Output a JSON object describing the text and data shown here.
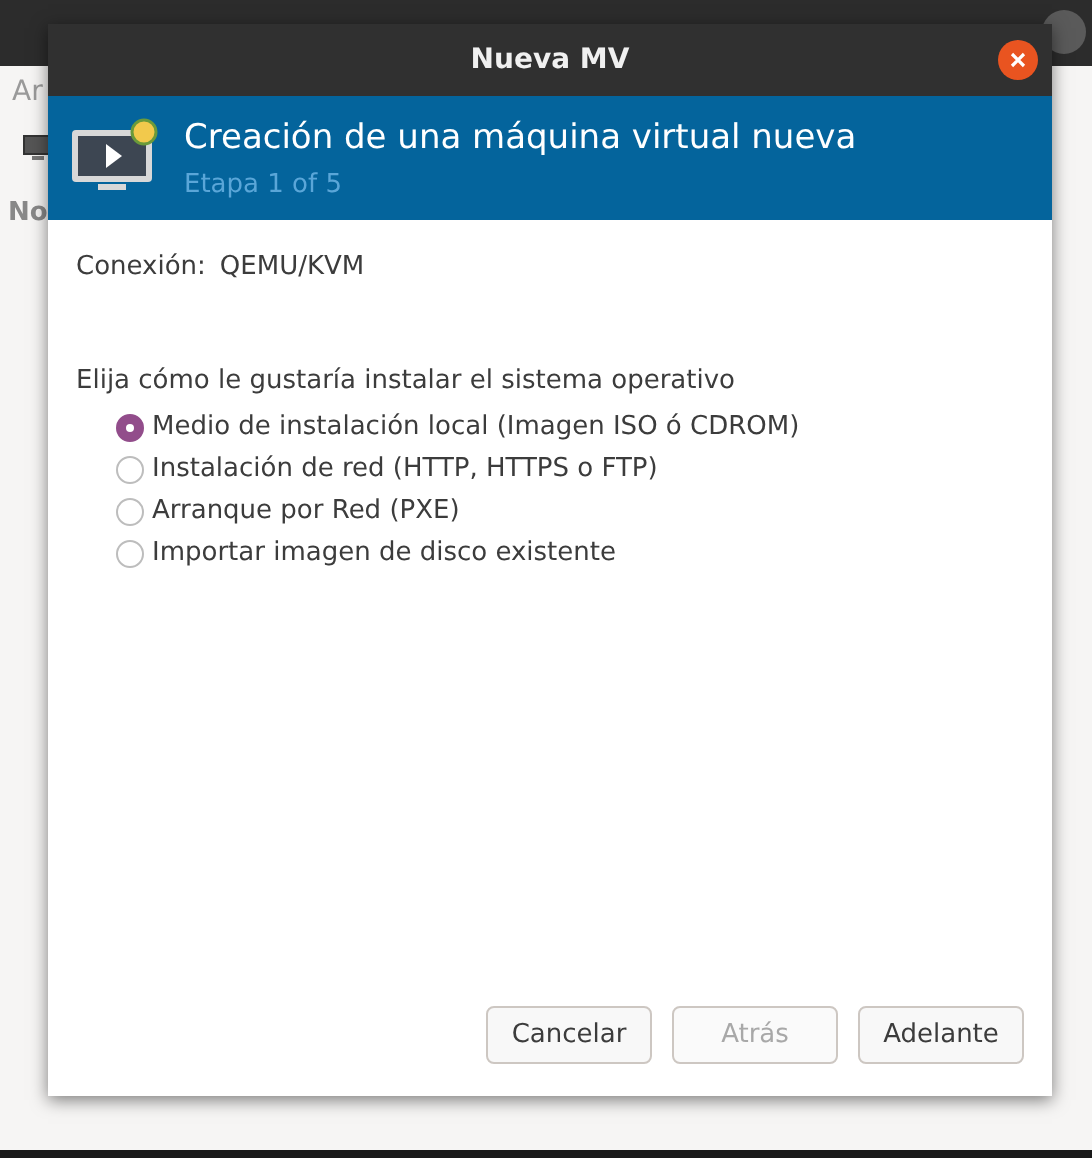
{
  "background_window": {
    "menu_text": "Ar",
    "column_text": "No"
  },
  "dialog": {
    "title": "Nueva MV"
  },
  "banner": {
    "title": "Creación de una máquina virtual nueva",
    "subtitle": "Etapa 1 of 5"
  },
  "connection": {
    "label": "Conexión:",
    "value": "QEMU/KVM"
  },
  "prompt": "Elija cómo le gustaría instalar el sistema operativo",
  "options": [
    {
      "label": "Medio de instalación local (Imagen ISO ó CDROM)",
      "selected": true
    },
    {
      "label": "Instalación de red (HTTP, HTTPS o FTP)",
      "selected": false
    },
    {
      "label": "Arranque por Red (PXE)",
      "selected": false
    },
    {
      "label": "Importar imagen de disco existente",
      "selected": false
    }
  ],
  "buttons": [
    {
      "label": "Cancelar",
      "disabled": false
    },
    {
      "label": "Atrás",
      "disabled": true
    },
    {
      "label": "Adelante",
      "disabled": false
    }
  ]
}
